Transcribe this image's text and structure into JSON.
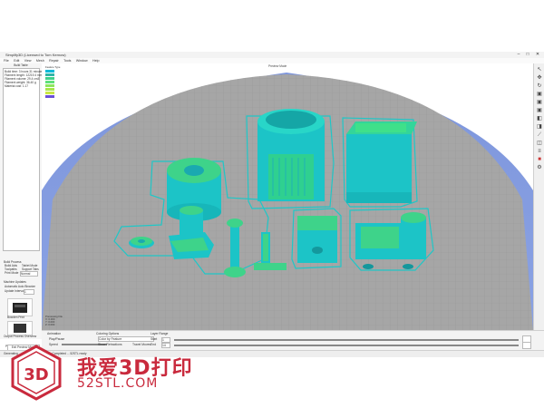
{
  "window": {
    "title": "Simplify3D (Licensed to Tom Kernow)"
  },
  "menu": [
    "File",
    "Edit",
    "View",
    "Mesh",
    "Repair",
    "Tools",
    "Window",
    "Help"
  ],
  "left_panel": {
    "models_header": "Build Table",
    "print_info_lines": [
      "Build time: 3 hours 31 minutes",
      "Filament length: 12219.4 mm",
      "Filament volume: 29.4 cm3",
      "Filament weight: 36.40 g",
      "Material cost: 1.17"
    ],
    "process_header": "Build Process",
    "process_items": [
      "Build Aids",
      "Tablet Mode",
      "Toolpaths",
      "Support Tabs"
    ],
    "print_label": "Print Mode",
    "print_value": "Normal",
    "firmware_header": "Machine Updates",
    "firmware_items": [
      "Automatic Auto Binarize"
    ],
    "update_label": "Update Interval",
    "update_value": "1",
    "thumb1_caption": "Bowden Print",
    "thumb2_caption": "Output Process Overview"
  },
  "viewport": {
    "title": "Preview Mode",
    "legend_title": "Feature Type",
    "legend_items": [
      {
        "color": "#00b8d8"
      },
      {
        "color": "#2fb5a8"
      },
      {
        "color": "#3fd08c"
      },
      {
        "color": "#5ee07a"
      },
      {
        "color": "#8ce65c"
      },
      {
        "color": "#a7e64c"
      },
      {
        "color": "#c9e843"
      },
      {
        "color": "#6b4fd8"
      }
    ],
    "stats_lines": [
      "Previewing File",
      "X: 0.000",
      "Y: 0.000",
      "Z: 0.000"
    ],
    "colors": {
      "grid_bg": "#a9a9a9",
      "grid_line": "#9a9a9a",
      "bed_blue": "#7f97d9",
      "cyan": "#1fc7c7",
      "green": "#3ed38a"
    }
  },
  "right_toolbar": {
    "icons": [
      "select-icon",
      "move-icon",
      "rotate-icon",
      "cube-front-icon",
      "cube-top-icon",
      "cube-side-icon",
      "cube-iso-icon",
      "cube-back-icon",
      "ruler-icon",
      "section-icon",
      "layers-icon",
      "camera-icon",
      "settings-icon"
    ]
  },
  "bottom_panel": {
    "animation_label": "Animation",
    "play_label": "Play/Pause",
    "speed_label": "Speed",
    "display_label": "Coloring Options",
    "color_by_label": "Color by Feature",
    "show_retractions": "Show Retractions",
    "show_travel": "Travel Moves",
    "layer_label": "Layer Range",
    "start_label": "Start",
    "end_label": "End",
    "start_value": "1",
    "end_value": "14",
    "sliders_label": "Position Slider",
    "exit_button": "Exit Preview Mode"
  },
  "status_bar": {
    "text": "Generating ...  Estimating print time ...  Completed ...  52STL ready"
  },
  "watermark": {
    "logo_text": "3D",
    "cn_text": "我爱3D打印",
    "url": "52STL.COM"
  }
}
